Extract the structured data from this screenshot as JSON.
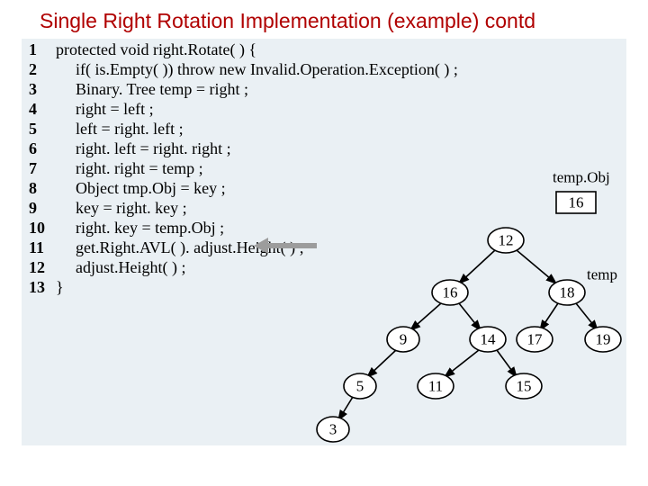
{
  "title": "Single Right Rotation Implementation (example) contd",
  "code": {
    "lines": [
      {
        "n": "1",
        "text": "protected void   right.Rotate( ) {",
        "indent": 0
      },
      {
        "n": "2",
        "text": "if( is.Empty( )) throw new Invalid.Operation.Exception( ) ;",
        "indent": 1
      },
      {
        "n": "3",
        "text": "Binary. Tree temp = right ;",
        "indent": 1
      },
      {
        "n": "4",
        "text": "right = left ;",
        "indent": 1
      },
      {
        "n": "5",
        "text": "left = right. left ;",
        "indent": 1
      },
      {
        "n": "6",
        "text": "right. left = right. right ;",
        "indent": 1
      },
      {
        "n": "7",
        "text": "right. right = temp ;",
        "indent": 1
      },
      {
        "n": "8",
        "text": "Object tmp.Obj = key ;",
        "indent": 1
      },
      {
        "n": "9",
        "text": "key = right. key ;",
        "indent": 1
      },
      {
        "n": "10",
        "text": "right. key = temp.Obj ;",
        "indent": 1
      },
      {
        "n": "11",
        "text": "get.Right.AVL( ). adjust.Height( ) ;",
        "indent": 1
      },
      {
        "n": "12",
        "text": "adjust.Height( ) ;",
        "indent": 1
      },
      {
        "n": "13",
        "text": "}",
        "indent": 0
      }
    ]
  },
  "diagram": {
    "labels": {
      "tempObj": "temp.Obj",
      "temp": "temp"
    },
    "nodes": {
      "n16box": "16",
      "n12": "12",
      "n16": "16",
      "n18": "18",
      "n9": "9",
      "n14": "14",
      "n17": "17",
      "n19": "19",
      "n5": "5",
      "n11": "11",
      "n15": "15",
      "n3": "3"
    }
  }
}
